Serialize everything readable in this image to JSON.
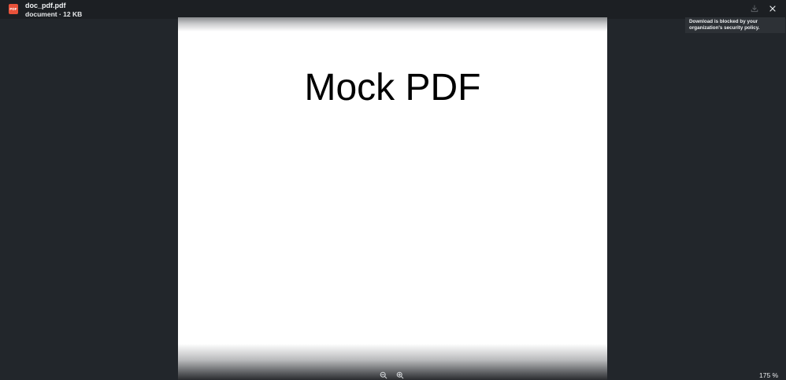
{
  "file": {
    "icon_label": "PDF",
    "name": "doc_pdf.pdf",
    "meta": "document · 12 KB"
  },
  "toolbar": {
    "download_icon": "download-icon",
    "close_icon": "close-icon",
    "download_tooltip_line1": "Download is blocked by your",
    "download_tooltip_line2": "organization's security policy."
  },
  "document": {
    "title": "Mock PDF"
  },
  "zoom": {
    "zoom_out_icon": "zoom-out-icon",
    "zoom_in_icon": "zoom-in-icon",
    "level": "175 %"
  },
  "colors": {
    "background": "#22262b",
    "topbar": "#1c1f23",
    "pdf_icon": "#e8523a",
    "tooltip_bg": "#2d3136"
  }
}
